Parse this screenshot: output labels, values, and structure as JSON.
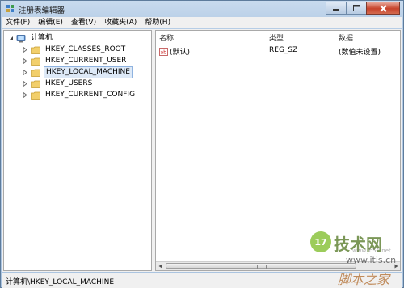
{
  "window": {
    "title": "注册表编辑器"
  },
  "menu": [
    "文件(F)",
    "编辑(E)",
    "查看(V)",
    "收藏夹(A)",
    "帮助(H)"
  ],
  "tree": {
    "root": "计算机",
    "items": [
      {
        "label": "HKEY_CLASSES_ROOT",
        "selected": false
      },
      {
        "label": "HKEY_CURRENT_USER",
        "selected": false
      },
      {
        "label": "HKEY_LOCAL_MACHINE",
        "selected": true
      },
      {
        "label": "HKEY_USERS",
        "selected": false
      },
      {
        "label": "HKEY_CURRENT_CONFIG",
        "selected": false
      }
    ]
  },
  "list": {
    "columns": [
      "名称",
      "类型",
      "数据"
    ],
    "rows": [
      {
        "name": "(默认)",
        "type": "REG_SZ",
        "data": "(数值未设置)",
        "icon": "string-value-icon"
      }
    ]
  },
  "status": "计算机\\HKEY_LOCAL_MACHINE",
  "watermark": {
    "brand": "技术网",
    "url": "www.itis.cn",
    "url_prefix": "www.jb51.net",
    "badge": "17",
    "footer": "脚本之家"
  },
  "colors": {
    "selection_bg": "#dde9f7",
    "selection_border": "#8fb3e0",
    "close_button": "#c7432b"
  }
}
